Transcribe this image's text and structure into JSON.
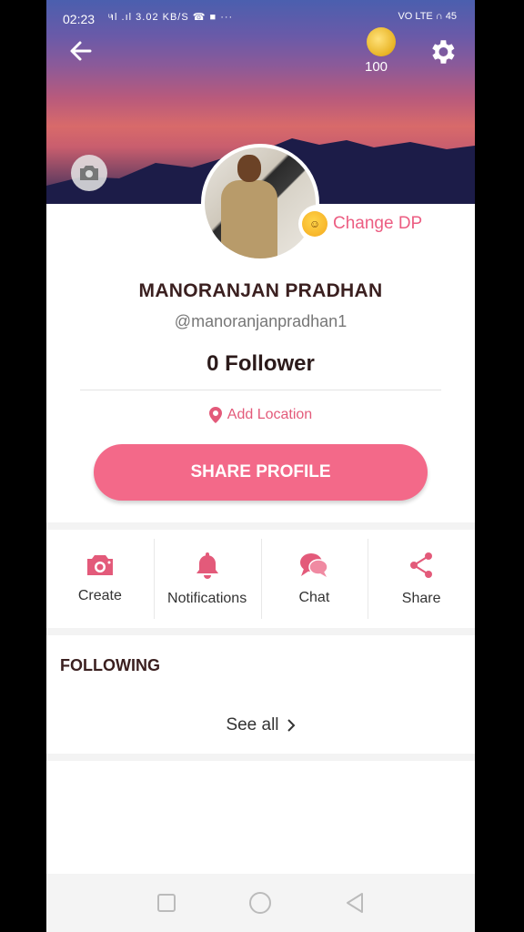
{
  "status_bar": {
    "time": "02:23",
    "left_icons_text": "ͧıl .ıl 3.02 KB/S ☎ ■ ···",
    "right_text": "VO LTE ∩ 45"
  },
  "header": {
    "coins": "100"
  },
  "profile": {
    "change_dp_label": "Change DP",
    "name": "MANORANJAN PRADHAN",
    "handle": "@manoranjanpradhan1",
    "followers": "0 Follower",
    "location_label": "Add Location",
    "share_button_label": "SHARE PROFILE"
  },
  "actions": [
    {
      "label": "Create",
      "icon": "camera-icon"
    },
    {
      "label": "Notifications",
      "icon": "bell-icon"
    },
    {
      "label": "Chat",
      "icon": "chat-bubbles-icon"
    },
    {
      "label": "Share",
      "icon": "share-icon"
    }
  ],
  "following": {
    "title": "FOLLOWING",
    "see_all_label": "See all"
  },
  "colors": {
    "accent": "#f36989",
    "accent_text": "#ec5d82",
    "title_text": "#3b2020"
  }
}
